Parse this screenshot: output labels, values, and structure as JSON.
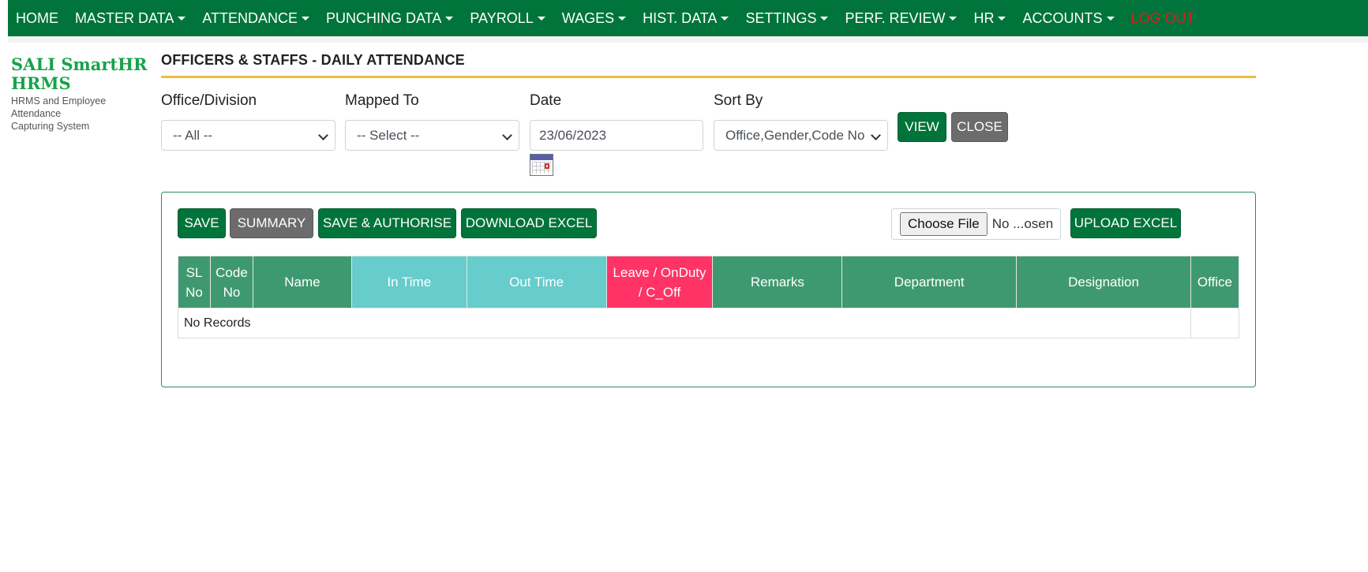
{
  "nav": {
    "items": [
      {
        "label": "HOME",
        "dropdown": false
      },
      {
        "label": "MASTER DATA",
        "dropdown": true
      },
      {
        "label": "ATTENDANCE",
        "dropdown": true
      },
      {
        "label": "PUNCHING DATA",
        "dropdown": true
      },
      {
        "label": "PAYROLL",
        "dropdown": true
      },
      {
        "label": "WAGES",
        "dropdown": true
      },
      {
        "label": "HIST. DATA",
        "dropdown": true
      },
      {
        "label": "SETTINGS",
        "dropdown": true
      },
      {
        "label": "PERF. REVIEW",
        "dropdown": true
      },
      {
        "label": "HR",
        "dropdown": true
      },
      {
        "label": "ACCOUNTS",
        "dropdown": true
      }
    ],
    "logout": "LOG OUT"
  },
  "brand": {
    "line1": "SALI SmartHR",
    "line2": "HRMS",
    "subtitle_line1": "HRMS and Employee Attendance",
    "subtitle_line2": "Capturing System"
  },
  "page": {
    "title": "OFFICERS & STAFFS - DAILY ATTENDANCE"
  },
  "filters": {
    "office_label": "Office/Division",
    "office_value": "-- All --",
    "mapped_label": "Mapped To",
    "mapped_value": "-- Select --",
    "date_label": "Date",
    "date_value": "23/06/2023",
    "sort_label": "Sort By",
    "sort_value": "Office,Gender,Code No"
  },
  "buttons": {
    "view": "VIEW",
    "close": "CLOSE",
    "save": "SAVE",
    "summary": "SUMMARY",
    "save_authorise": "SAVE & AUTHORISE",
    "download_excel": "DOWNLOAD EXCEL",
    "choose_file": "Choose File",
    "no_file": "No ...osen",
    "upload_excel": "UPLOAD EXCEL"
  },
  "table": {
    "headers": {
      "sl_no_1": "SL",
      "sl_no_2": "No",
      "code_no_1": "Code",
      "code_no_2": "No",
      "name": "Name",
      "in_time": "In Time",
      "out_time": "Out Time",
      "leave_1": "Leave / OnDuty",
      "leave_2": "/ C_Off",
      "remarks": "Remarks",
      "department": "Department",
      "designation": "Designation",
      "office": "Office"
    },
    "empty_text": "No Records"
  },
  "colors": {
    "nav_bg": "#00743a",
    "logout": "#d9201e",
    "brand": "#16a34a",
    "accent_rule": "#f0bd3b",
    "header_green": "#3f9970",
    "header_teal": "#66cccc",
    "header_pink": "#ff3366"
  }
}
